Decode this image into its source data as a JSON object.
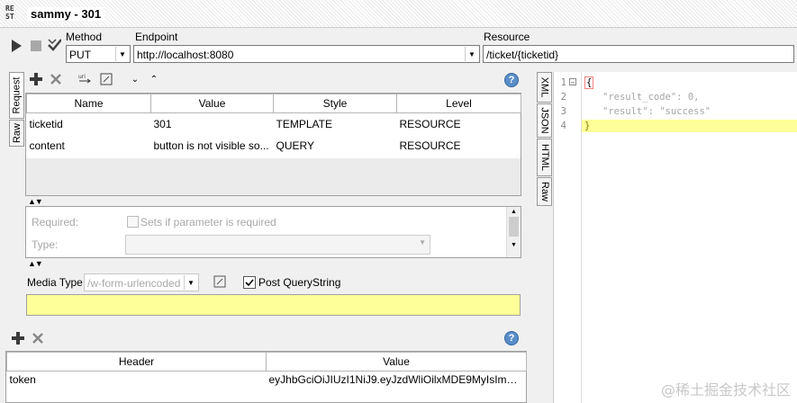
{
  "window": {
    "logo": "RE ST",
    "title": "sammy - 301"
  },
  "toolbar": {
    "method_label": "Method",
    "method_value": "PUT",
    "endpoint_label": "Endpoint",
    "endpoint_value": "http://localhost:8080",
    "resource_label": "Resource",
    "resource_value": "/ticket/{ticketid}"
  },
  "left_tabs": [
    "Request",
    "Raw"
  ],
  "params": {
    "columns": [
      "Name",
      "Value",
      "Style",
      "Level"
    ],
    "rows": [
      {
        "name": "ticketid",
        "value": "301",
        "style": "TEMPLATE",
        "level": "RESOURCE"
      },
      {
        "name": "content",
        "value": "button is not visible so...",
        "style": "QUERY",
        "level": "RESOURCE"
      }
    ]
  },
  "param_details": {
    "required_label": "Required:",
    "required_check_label": "Sets if parameter is required",
    "type_label": "Type:"
  },
  "media": {
    "label": "Media Type",
    "value": "/w-form-urlencoded",
    "post_querystring_label": "Post QueryString",
    "post_querystring_checked": true
  },
  "headers": {
    "columns": [
      "Header",
      "Value"
    ],
    "rows": [
      {
        "header": "token",
        "value": "eyJhbGciOiJIUzI1NiJ9.eyJzdWliOilxMDE9MyIsImV4c..."
      }
    ]
  },
  "response_tabs": [
    "XML",
    "JSON",
    "HTML",
    "Raw"
  ],
  "response": {
    "line_numbers": [
      "1",
      "2",
      "3",
      "4"
    ],
    "lines": [
      "{",
      "\"result_code\": 0,",
      "\"result\": \"success\"",
      "}"
    ]
  },
  "watermark": "@稀土掘金技术社区",
  "colors": {
    "highlight": "#ffff99",
    "string": "#a6a6a6",
    "selection": "#ffffa8"
  },
  "icons": [
    "play-icon",
    "stop-icon",
    "tick-icon",
    "add-icon",
    "remove-icon",
    "encode-icon",
    "edit-icon",
    "move-down-icon",
    "move-up-icon",
    "help-icon"
  ]
}
